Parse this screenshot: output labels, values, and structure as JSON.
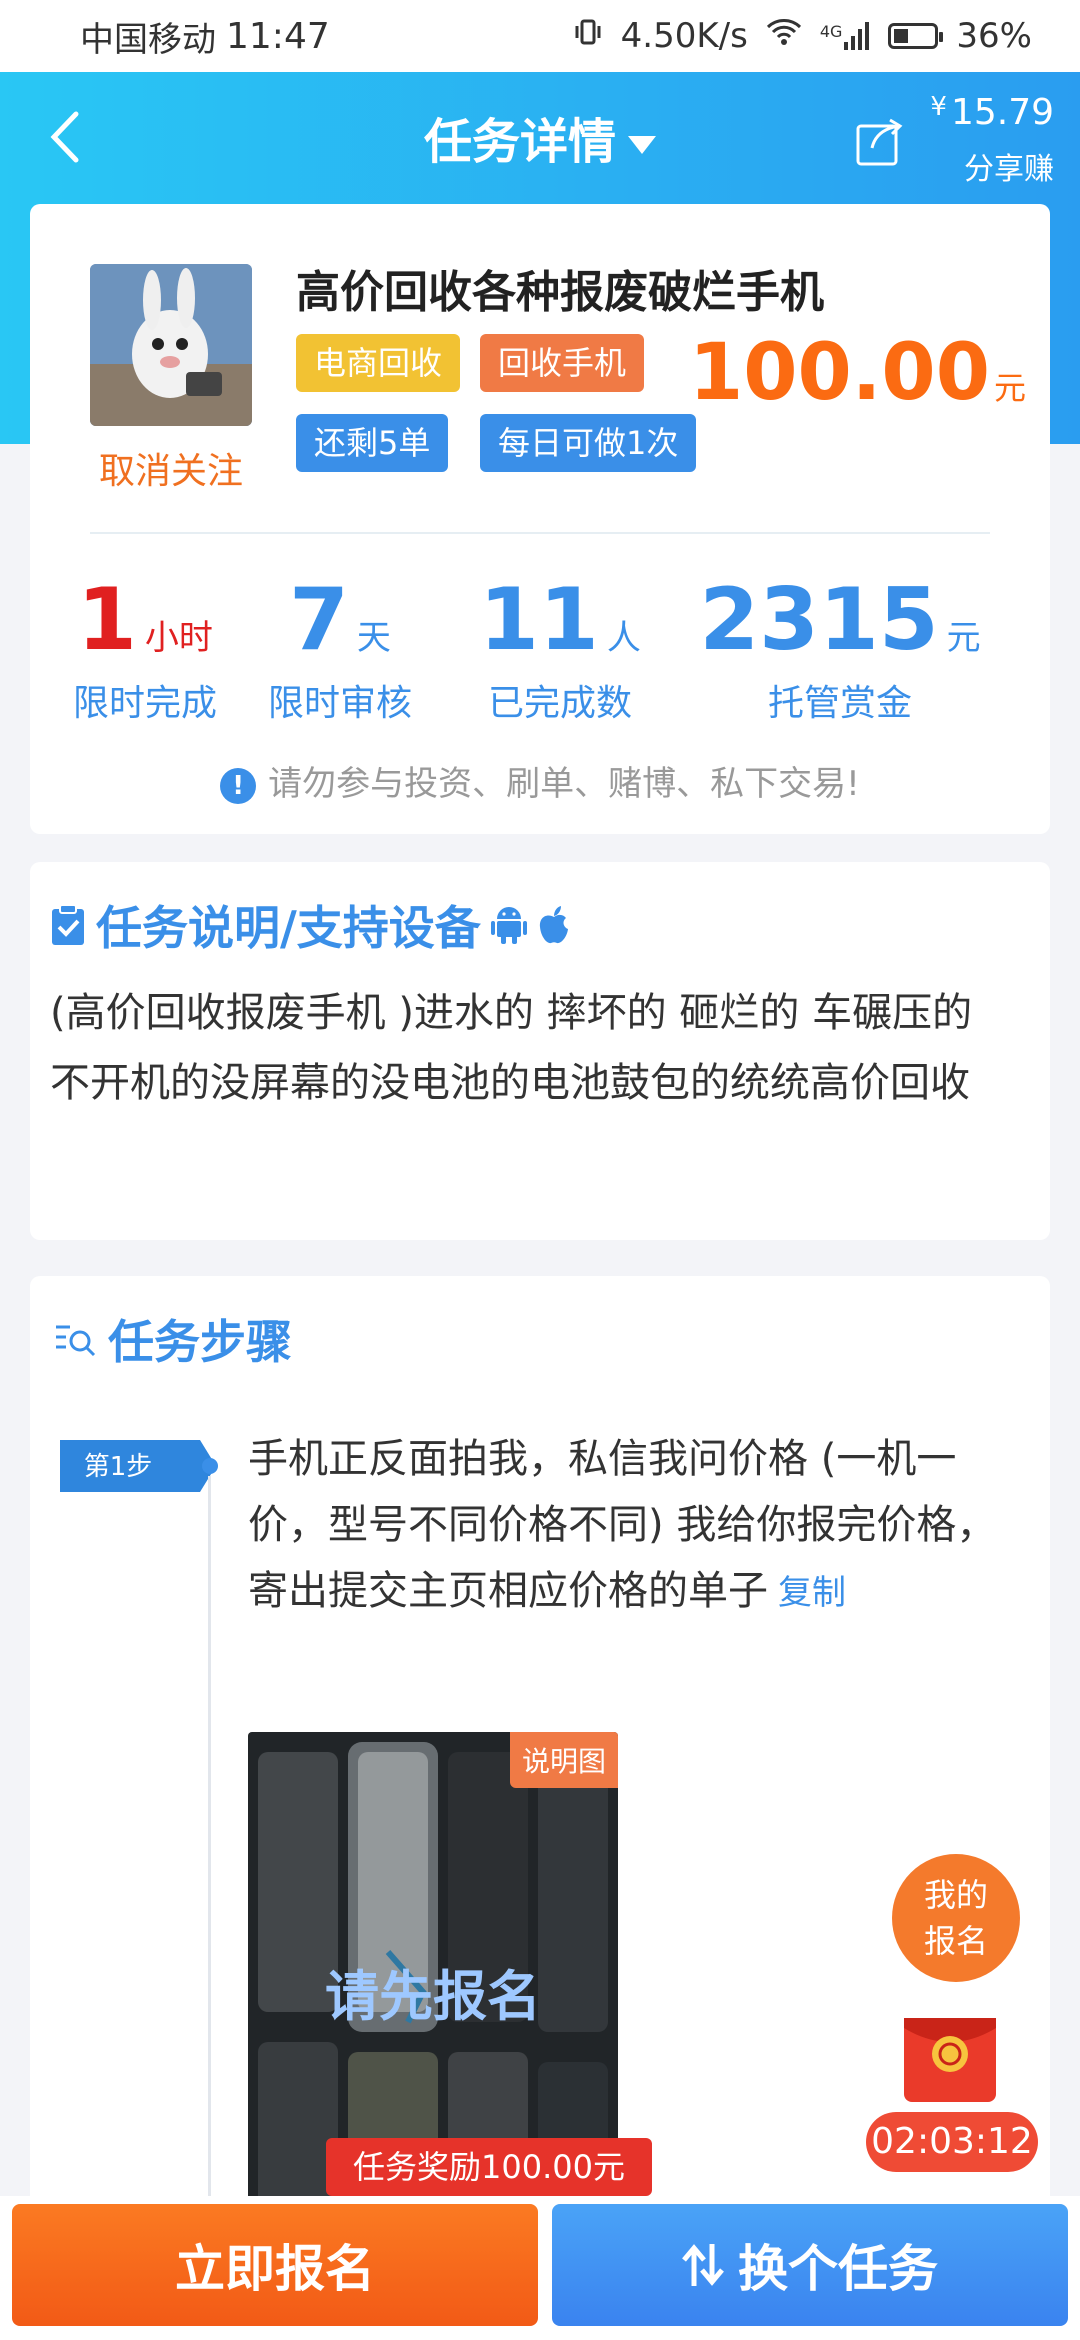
{
  "status_bar": {
    "carrier": "中国移动",
    "time": "11:47",
    "speed": "4.50K/s",
    "network": "4G",
    "battery": "36%"
  },
  "nav": {
    "title": "任务详情",
    "share_amount": "15.79",
    "share_currency": "¥",
    "share_label": "分享赚"
  },
  "task": {
    "title": "高价回收各种报废破烂手机",
    "unfollow": "取消关注",
    "tags": [
      "电商回收",
      "回收手机",
      "还剩5单",
      "每日可做1次"
    ],
    "price": "100.00",
    "price_unit": "元",
    "stats": [
      {
        "value": "1",
        "unit": "小时",
        "label": "限时完成"
      },
      {
        "value": "7",
        "unit": "天",
        "label": "限时审核"
      },
      {
        "value": "11",
        "unit": "人",
        "label": "已完成数"
      },
      {
        "value": "2315",
        "unit": "元",
        "label": "托管赏金"
      }
    ],
    "warning": "请勿参与投资、刷单、赌博、私下交易!"
  },
  "description": {
    "title": "任务说明/支持设备",
    "text": "(高价回收报废手机 )进水的 摔坏的 砸烂的 车碾压的不开机的没屏幕的没电池的电池鼓包的统统高价回收"
  },
  "steps": {
    "title": "任务步骤",
    "step_label": "第1步",
    "step_text": "手机正反面拍我，私信我问价格 (一机一价，型号不同价格不同) 我给你报完价格，寄出提交主页相应价格的单子",
    "copy": "复制",
    "image_label": "说明图",
    "image_cta": "请先报名"
  },
  "floating": {
    "my_signup": "我的报名",
    "timer": "02:03:12"
  },
  "bottom": {
    "reward_tip": "任务奖励100.00元",
    "apply": "立即报名",
    "change": "换个任务"
  },
  "colors": {
    "primary_blue": "#3a8fe8",
    "orange": "#f25a16",
    "red": "#e6332a"
  }
}
